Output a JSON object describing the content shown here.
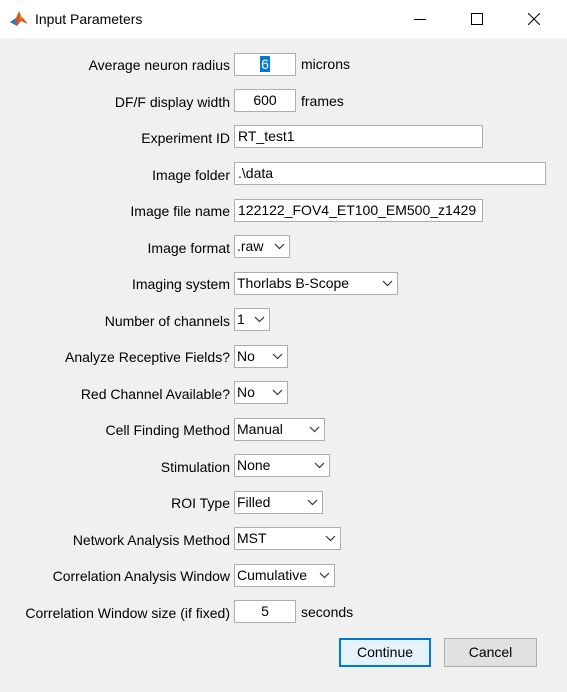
{
  "window": {
    "title": "Input Parameters",
    "icon": "matlab-icon"
  },
  "fields": {
    "neuron_radius": {
      "label": "Average neuron radius",
      "value": "6",
      "unit": "microns"
    },
    "dff_width": {
      "label": "DF/F display width",
      "value": "600",
      "unit": "frames"
    },
    "experiment_id": {
      "label": "Experiment ID",
      "value": "RT_test1"
    },
    "image_folder": {
      "label": "Image folder",
      "value": ".\\data"
    },
    "image_file_name": {
      "label": "Image file name",
      "value": "122122_FOV4_ET100_EM500_z1429"
    },
    "image_format": {
      "label": "Image format",
      "value": ".raw"
    },
    "imaging_system": {
      "label": "Imaging system",
      "value": "Thorlabs B-Scope"
    },
    "num_channels": {
      "label": "Number of channels",
      "value": "1"
    },
    "analyze_rf": {
      "label": "Analyze Receptive Fields?",
      "value": "No"
    },
    "red_channel": {
      "label": "Red Channel Available?",
      "value": "No"
    },
    "cell_finding": {
      "label": "Cell Finding Method",
      "value": "Manual"
    },
    "stimulation": {
      "label": "Stimulation",
      "value": "None"
    },
    "roi_type": {
      "label": "ROI Type",
      "value": "Filled"
    },
    "network_method": {
      "label": "Network Analysis Method",
      "value": "MST"
    },
    "corr_window": {
      "label": "Correlation Analysis Window",
      "value": "Cumulative"
    },
    "corr_window_size": {
      "label": "Correlation Window size (if fixed)",
      "value": "5",
      "unit": "seconds"
    }
  },
  "buttons": {
    "continue": "Continue",
    "cancel": "Cancel"
  }
}
